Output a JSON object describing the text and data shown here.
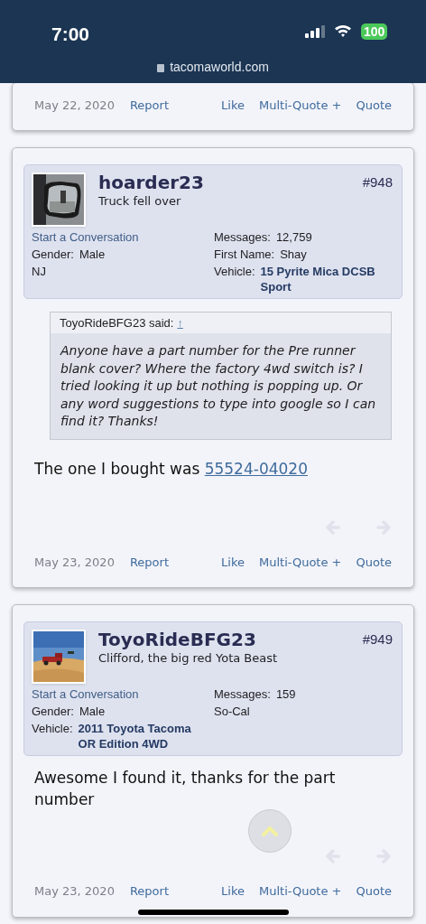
{
  "status_bar": {
    "time": "7:00",
    "battery": "100",
    "url": "tacomaworld.com"
  },
  "posts": [
    {
      "kind": "footer_only",
      "date": "May 22, 2020",
      "report": "Report",
      "actions": [
        "Like",
        "Multi-Quote +",
        "Quote"
      ]
    },
    {
      "kind": "full",
      "author": {
        "name": "hoarder23",
        "title": "Truck fell over",
        "number": "#948",
        "left": [
          {
            "kind": "link",
            "text": "Start a Conversation"
          },
          {
            "kind": "field",
            "label": "Gender:",
            "value": "Male"
          },
          {
            "kind": "text",
            "text": "NJ"
          }
        ],
        "right": [
          {
            "kind": "field",
            "label": "Messages:",
            "value": "12,759"
          },
          {
            "kind": "field",
            "label": "First Name:",
            "value": "Shay"
          },
          {
            "kind": "vehicle",
            "label": "Vehicle:",
            "value": "15 Pyrite Mica DCSB Sport"
          }
        ]
      },
      "quote": {
        "author": "ToyoRideBFG23 said:",
        "arrow": "↑",
        "text": "Anyone have a part number for the Pre runner blank cover? Where the factory 4wd switch is? I tried looking it up but nothing is popping up. Or any word suggestions to type into google so I can find it? Thanks!"
      },
      "message": "The one I bought was",
      "link": "55524-04020",
      "date": "May 23, 2020",
      "report": "Report",
      "actions": [
        "Like",
        "Multi-Quote +",
        "Quote"
      ]
    },
    {
      "kind": "full",
      "author": {
        "name": "ToyoRideBFG23",
        "title": "Clifford, the big red Yota Beast",
        "number": "#949",
        "left": [
          {
            "kind": "link",
            "text": "Start a Conversation"
          },
          {
            "kind": "field",
            "label": "Gender:",
            "value": "Male"
          },
          {
            "kind": "vehicle",
            "label": "Vehicle:",
            "value": "2011 Toyota Tacoma OR Edition 4WD"
          }
        ],
        "right": [
          {
            "kind": "field",
            "label": "Messages:",
            "value": "159"
          },
          {
            "kind": "text",
            "text": "So-Cal"
          }
        ]
      },
      "message": "Awesome I found it, thanks for the part number",
      "date": "May 23, 2020",
      "report": "Report",
      "actions": [
        "Like",
        "Multi-Quote +",
        "Quote"
      ],
      "scroll_top": true
    }
  ]
}
